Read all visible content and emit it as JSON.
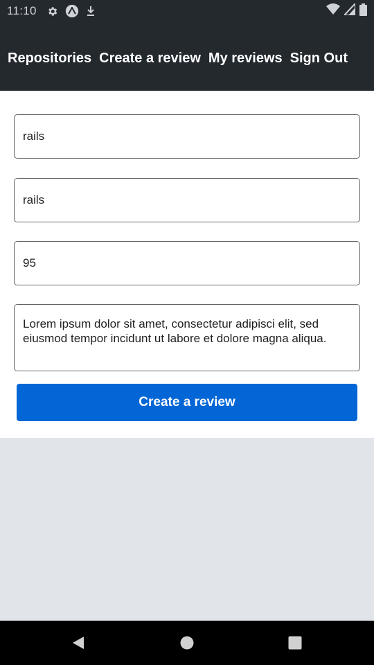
{
  "status_bar": {
    "time": "11:10",
    "left_icons": [
      "gear-icon",
      "expo-logo-icon",
      "download-icon"
    ],
    "right_icons": [
      "wifi-icon",
      "cell-signal-icon",
      "battery-icon"
    ]
  },
  "nav": {
    "tabs": [
      {
        "label": "Repositories"
      },
      {
        "label": "Create a review"
      },
      {
        "label": "My reviews"
      },
      {
        "label": "Sign Out"
      }
    ]
  },
  "form": {
    "owner_value": "rails",
    "repository_value": "rails",
    "rating_value": "95",
    "review_value": "Lorem ipsum dolor sit amet, consectetur adipisci elit, sed eiusmod tempor incidunt ut labore et dolore magna aliqua.",
    "submit_label": "Create a review"
  },
  "system_nav": {
    "buttons": [
      "back-icon",
      "home-icon",
      "recents-icon"
    ]
  },
  "colors": {
    "app_bar": "#24292e",
    "primary": "#0366d6",
    "background": "#e1e4e8"
  }
}
